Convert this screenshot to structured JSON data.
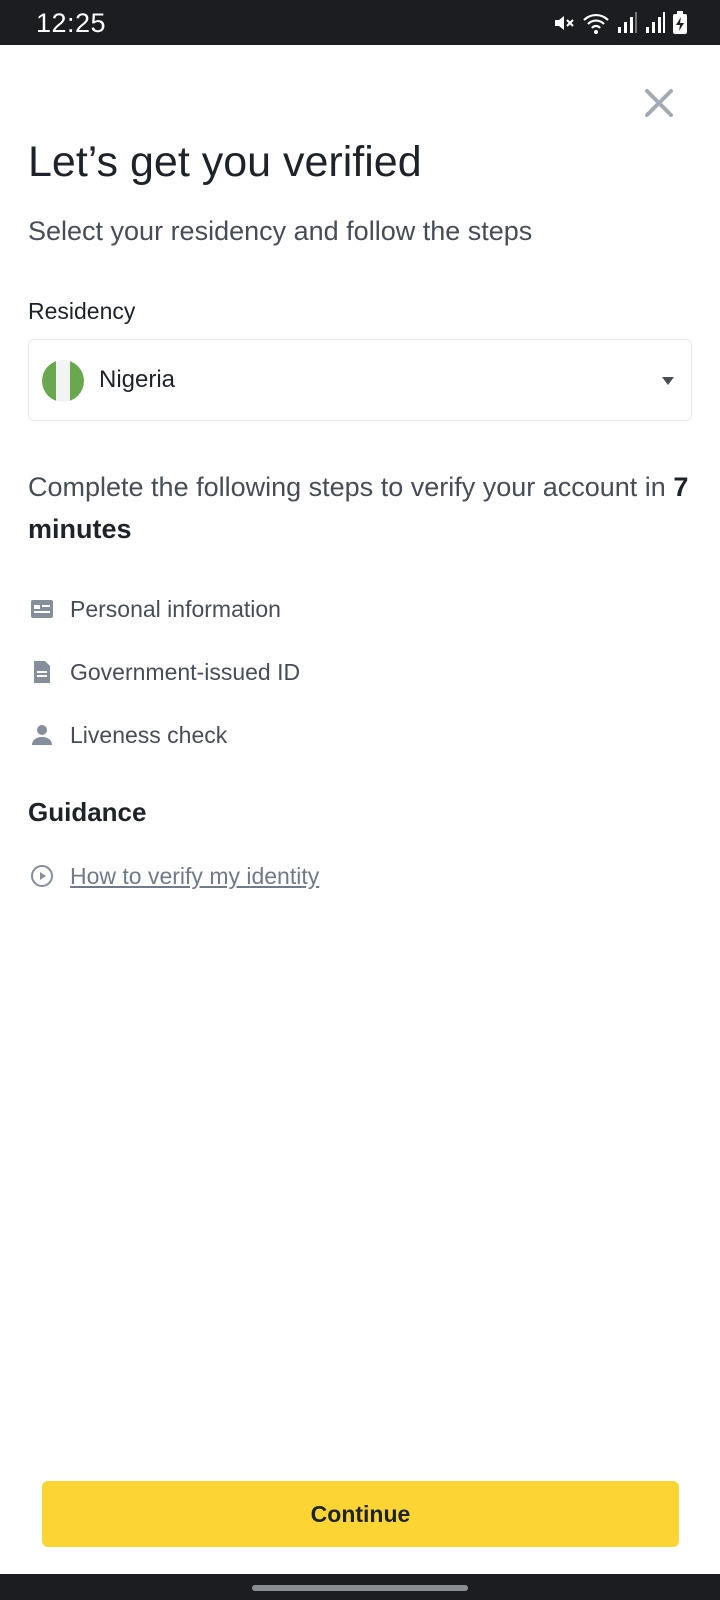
{
  "status_bar": {
    "time": "12:25",
    "icons": [
      "mute-icon",
      "wifi-icon",
      "signal-icon",
      "signal-icon",
      "battery-charging-icon"
    ]
  },
  "header": {
    "close_icon": "close-icon",
    "title": "Let’s get you verified",
    "subtitle": "Select your residency and follow the steps"
  },
  "residency": {
    "label": "Residency",
    "selected_country": "Nigeria",
    "flag_colors": [
      "#6aa84f",
      "#f3f3f3",
      "#6aa84f"
    ]
  },
  "steps": {
    "intro_prefix": "Complete the following steps to verify your account in ",
    "intro_duration": "7 minutes",
    "items": [
      {
        "label": "Personal information",
        "icon": "id-card-icon"
      },
      {
        "label": "Government-issued ID",
        "icon": "document-icon"
      },
      {
        "label": "Liveness check",
        "icon": "person-icon"
      }
    ]
  },
  "guidance": {
    "title": "Guidance",
    "link_label": "How to verify my identity",
    "link_icon": "play-circle-icon"
  },
  "footer": {
    "continue_label": "Continue"
  },
  "colors": {
    "accent": "#fcd535",
    "text_primary": "#1e2329",
    "text_secondary": "#474d57",
    "icon_gray": "#858e9b"
  }
}
